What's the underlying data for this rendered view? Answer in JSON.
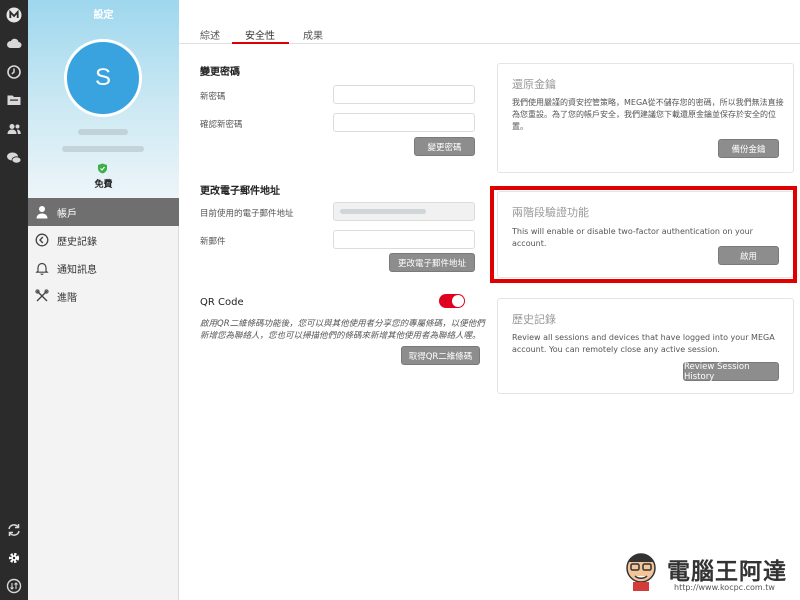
{
  "sidebar": {
    "title": "設定",
    "avatar_letter": "S",
    "plan": "免費",
    "items": [
      {
        "label": "帳戶",
        "icon": "user-icon",
        "active": true
      },
      {
        "label": "歷史記錄",
        "icon": "history-icon",
        "active": false
      },
      {
        "label": "通知訊息",
        "icon": "bell-icon",
        "active": false
      },
      {
        "label": "進階",
        "icon": "tools-icon",
        "active": false
      }
    ]
  },
  "rail": {
    "icons": [
      "mega-logo-icon",
      "cloud-drive-icon",
      "recents-icon",
      "shared-folders-icon",
      "contacts-icon",
      "chat-icon",
      "sync-icon",
      "settings-gear-icon",
      "transfers-icon"
    ]
  },
  "tabs": [
    {
      "label": "綜述"
    },
    {
      "label": "安全性",
      "active": true
    },
    {
      "label": "成果"
    }
  ],
  "password": {
    "title": "變更密碼",
    "new_label": "新密碼",
    "confirm_label": "確認新密碼",
    "button": "變更密碼"
  },
  "email": {
    "title": "更改電子郵件地址",
    "current_label": "目前使用的電子郵件地址",
    "new_label": "新郵件",
    "button": "更改電子郵件地址"
  },
  "qr": {
    "title": "QR Code",
    "enabled": true,
    "description": "啟用QR二維條碼功能後，您可以與其他使用者分享您的專屬條碼，以便他們新增您為聯絡人，您也可以掃描他們的條碼來新增其他使用者為聯絡人喔。",
    "button": "取得QR二維條碼"
  },
  "recovery": {
    "title": "還原金鑰",
    "description": "我們使用嚴謹的資安控管策略，MEGA從不儲存您的密碼，所以我們無法直接為您重設。為了您的帳戶安全，我們建議您下載還原金鑰並保存於安全的位置。",
    "button": "備份金鑰"
  },
  "twofa": {
    "title": "兩階段驗證功能",
    "description": "This will enable or disable two-factor authentication on your account.",
    "button": "啟用"
  },
  "history": {
    "title": "歷史記錄",
    "description": "Review all sessions and devices that have logged into your MEGA account. You can remotely close any active session.",
    "button": "Review Session History"
  },
  "watermark": {
    "text": "電腦王阿達",
    "url": "http://www.kocpc.com.tw"
  },
  "colors": {
    "accent": "#d90007",
    "highlight": "#e00000",
    "avatar": "#38a3df",
    "rail": "#2b2b2b",
    "active_nav": "#6f6f6f"
  }
}
